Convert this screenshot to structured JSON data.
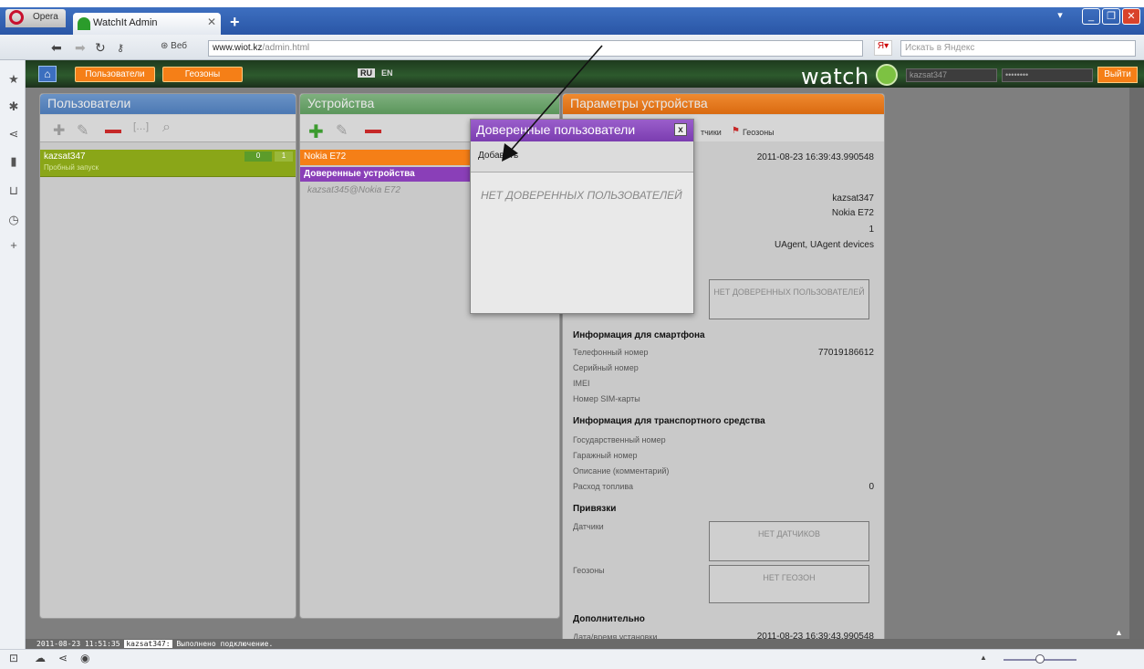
{
  "browser": {
    "menu_label": "Opera",
    "tab_title": "WatchIt Admin",
    "web_badge": "Веб",
    "address_host": "www.wiot.kz",
    "address_path": "/admin.html",
    "search_placeholder": "Искать в Яндекс"
  },
  "app": {
    "nav": {
      "users": "Пользователи",
      "geozones": "Геозоны"
    },
    "lang": {
      "ru": "RU",
      "en": "EN"
    },
    "brand": "watch",
    "login_value": "kazsat347",
    "password_value": "••••••••",
    "logout_label": "Выйти"
  },
  "users_panel": {
    "title": "Пользователи",
    "user": {
      "name": "kazsat347",
      "subtitle": "Пробный запуск",
      "count_a": "0",
      "count_b": "1"
    }
  },
  "devices_panel": {
    "title": "Устройства",
    "device": "Nokia E72",
    "trusted_title": "Доверенные устройства",
    "trusted_item": "kazsat345@Nokia E72"
  },
  "params_panel": {
    "title": "Параметры устройства",
    "tabs": {
      "sensors": "тчики",
      "geozones": "Геозоны"
    },
    "timestamp": "2011-08-23 16:39:43.990548",
    "owner": "kazsat347",
    "model": "Nokia E72",
    "number": "1",
    "groups": "UAgent, UAgent devices",
    "no_trusted": "НЕТ ДОВЕРЕННЫХ ПОЛЬЗОВАТЕЛЕЙ",
    "smartphone": {
      "title": "Информация для смартфона",
      "phone_label": "Телефонный номер",
      "phone_value": "77019186612",
      "serial_label": "Серийный номер",
      "imei_label": "IMEI",
      "sim_label": "Номер SIM-карты"
    },
    "vehicle": {
      "title": "Информация для транспортного средства",
      "plate_label": "Государственный номер",
      "garage_label": "Гаражный номер",
      "desc_label": "Описание (комментарий)",
      "fuel_label": "Расход топлива",
      "fuel_value": "0"
    },
    "bindings": {
      "title": "Привязки",
      "sensors_label": "Датчики",
      "sensors_empty": "НЕТ ДАТЧИКОВ",
      "geozones_label": "Геозоны",
      "geozones_empty": "НЕТ ГЕОЗОН"
    },
    "extra": {
      "title": "Дополнительно",
      "install_label": "Дата/время установки",
      "install_value": "2011-08-23 16:39:43.990548"
    }
  },
  "dialog": {
    "title": "Доверенные пользователи",
    "close": "x",
    "add_label": "Добавить",
    "empty_text": "НЕТ ДОВЕРЕННЫХ ПОЛЬЗОВАТЕЛЕЙ"
  },
  "status": {
    "time": "2011-08-23 11:51:35",
    "user": "kazsat347:",
    "message": "Выполнено подключение."
  },
  "colors": {
    "orange": "#f57f17",
    "users_head": "#4c78b3",
    "devices_head": "#5b965b",
    "params_head": "#d96a10",
    "dialog_head": "#7b3db0",
    "user_row": "#8aa618",
    "brand_leaf": "#7dc242"
  }
}
